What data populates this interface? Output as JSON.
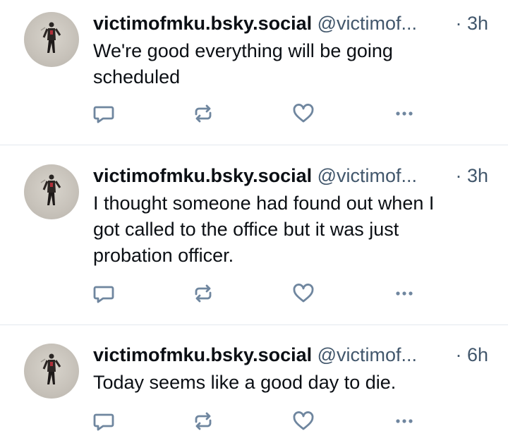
{
  "posts": [
    {
      "author": "victimofmku.bsky.social",
      "handle": "@victimof...",
      "time": "· 3h",
      "text": "We're good everything will be going\nscheduled"
    },
    {
      "author": "victimofmku.bsky.social",
      "handle": "@victimof...",
      "time": "· 3h",
      "text": "I thought someone had found out when I\ngot called to the office but it was just\nprobation officer."
    },
    {
      "author": "victimofmku.bsky.social",
      "handle": "@victimof...",
      "time": "· 6h",
      "text": "Today seems like a good day to die."
    }
  ],
  "icons": {
    "reply": "reply-icon",
    "repost": "repost-icon",
    "like": "like-icon",
    "more": "more-icon"
  },
  "colors": {
    "text": "#0b0f14",
    "muted": "#42576c",
    "icon": "#6f869f",
    "divider": "#e3e8ee"
  }
}
